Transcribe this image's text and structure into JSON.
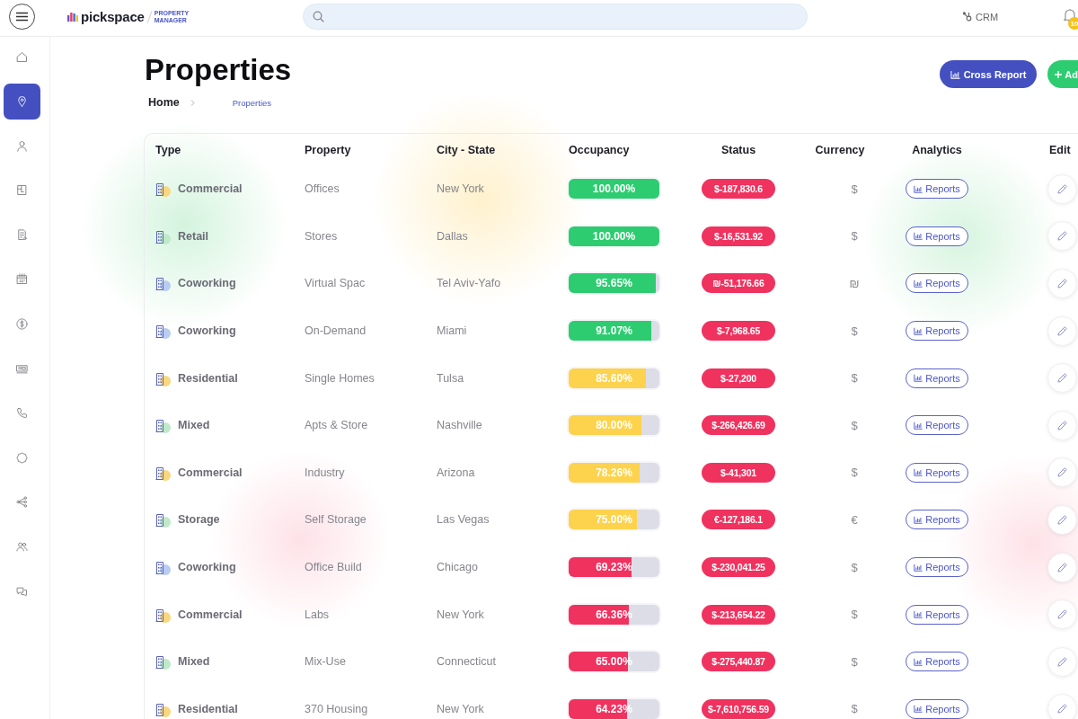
{
  "topbar": {
    "logo": {
      "name": "pickspace",
      "tagline": "PROPERTY MANAGER"
    },
    "crm_link": "CRM",
    "notifications": {
      "count": "10"
    }
  },
  "sidebar": {
    "items": [
      {
        "selected": false
      },
      {
        "selected": true
      },
      {
        "selected": false
      },
      {
        "selected": false
      },
      {
        "selected": false
      },
      {
        "selected": false
      },
      {
        "selected": false
      },
      {
        "selected": false
      },
      {
        "selected": false
      },
      {
        "selected": false
      },
      {
        "selected": false
      },
      {
        "selected": false
      },
      {
        "selected": false
      }
    ]
  },
  "page": {
    "title": "Properties",
    "breadcrumb": [
      {
        "label": "Home",
        "current": false
      },
      {
        "label": "Properties",
        "current": true
      }
    ],
    "actions": [
      {
        "kind": "report",
        "label": "Cross Report"
      },
      {
        "kind": "add",
        "label": "Ad"
      }
    ]
  },
  "table": {
    "columns": [
      "Type",
      "Property",
      "City - State",
      "Occupancy",
      "Status",
      "Currency",
      "Analytics",
      "Edit"
    ],
    "rows": [
      {
        "type": {
          "label": "Commercial",
          "color": "#f9d77e"
        },
        "property": "Offices",
        "city": "New York",
        "occupancy": {
          "text": "100.00%",
          "level": 1,
          "color": "#2dcc70"
        },
        "status": "$-187,830.6",
        "currency": "$",
        "analytics": "Reports"
      },
      {
        "type": {
          "label": "Retail",
          "color": "#bfe9c9"
        },
        "property": "Stores",
        "city": "Dallas",
        "occupancy": {
          "text": "100.00%",
          "level": 1,
          "color": "#2dcc70"
        },
        "status": "$-16,531.92",
        "currency": "$",
        "analytics": "Reports"
      },
      {
        "type": {
          "label": "Coworking",
          "color": "#b9cdf2"
        },
        "property": "Virtual Spac",
        "city": "Tel Aviv-Yafo",
        "occupancy": {
          "text": "95.65%",
          "level": 0.9565,
          "color": "#2dcc70"
        },
        "status": "₪-51,176.66",
        "currency": "₪",
        "analytics": "Reports"
      },
      {
        "type": {
          "label": "Coworking",
          "color": "#b9cdf2"
        },
        "property": "On-Demand",
        "city": "Miami",
        "occupancy": {
          "text": "91.07%",
          "level": 0.9107,
          "color": "#2dcc70"
        },
        "status": "$-7,968.65",
        "currency": "$",
        "analytics": "Reports"
      },
      {
        "type": {
          "label": "Residential",
          "color": "#f9d77e"
        },
        "property": "Single Homes",
        "city": "Tulsa",
        "occupancy": {
          "text": "85.60%",
          "level": 0.856,
          "color": "#fdd24c"
        },
        "status": "$-27,200",
        "currency": "$",
        "analytics": "Reports"
      },
      {
        "type": {
          "label": "Mixed",
          "color": "#bfe9c9"
        },
        "property": "Apts & Store",
        "city": "Nashville",
        "occupancy": {
          "text": "80.00%",
          "level": 0.8,
          "color": "#fdd24c"
        },
        "status": "$-266,426.69",
        "currency": "$",
        "analytics": "Reports"
      },
      {
        "type": {
          "label": "Commercial",
          "color": "#f9d77e"
        },
        "property": "Industry",
        "city": "Arizona",
        "occupancy": {
          "text": "78.26%",
          "level": 0.7826,
          "color": "#fdd24c"
        },
        "status": "$-41,301",
        "currency": "$",
        "analytics": "Reports"
      },
      {
        "type": {
          "label": "Storage",
          "color": "#bfe9c9"
        },
        "property": "Self Storage",
        "city": "Las Vegas",
        "occupancy": {
          "text": "75.00%",
          "level": 0.75,
          "color": "#fdd24c"
        },
        "status": "€-127,186.1",
        "currency": "€",
        "analytics": "Reports"
      },
      {
        "type": {
          "label": "Coworking",
          "color": "#b9cdf2"
        },
        "property": "Office Build",
        "city": "Chicago",
        "occupancy": {
          "text": "69.23%",
          "level": 0.6923,
          "color": "#f0325f"
        },
        "status": "$-230,041.25",
        "currency": "$",
        "analytics": "Reports"
      },
      {
        "type": {
          "label": "Commercial",
          "color": "#f9d77e"
        },
        "property": "Labs",
        "city": "New York",
        "occupancy": {
          "text": "66.36%",
          "level": 0.6636,
          "color": "#f0325f"
        },
        "status": "$-213,654.22",
        "currency": "$",
        "analytics": "Reports"
      },
      {
        "type": {
          "label": "Mixed",
          "color": "#bfe9c9"
        },
        "property": "Mix-Use",
        "city": "Connecticut",
        "occupancy": {
          "text": "65.00%",
          "level": 0.65,
          "color": "#f0325f"
        },
        "status": "$-275,440.87",
        "currency": "$",
        "analytics": "Reports"
      },
      {
        "type": {
          "label": "Residential",
          "color": "#f9d77e"
        },
        "property": "370 Housing",
        "city": "New York",
        "occupancy": {
          "text": "64.23%",
          "level": 0.6423,
          "color": "#f0325f"
        },
        "status": "$-7,610,756.59",
        "currency": "$",
        "analytics": "Reports"
      }
    ]
  }
}
